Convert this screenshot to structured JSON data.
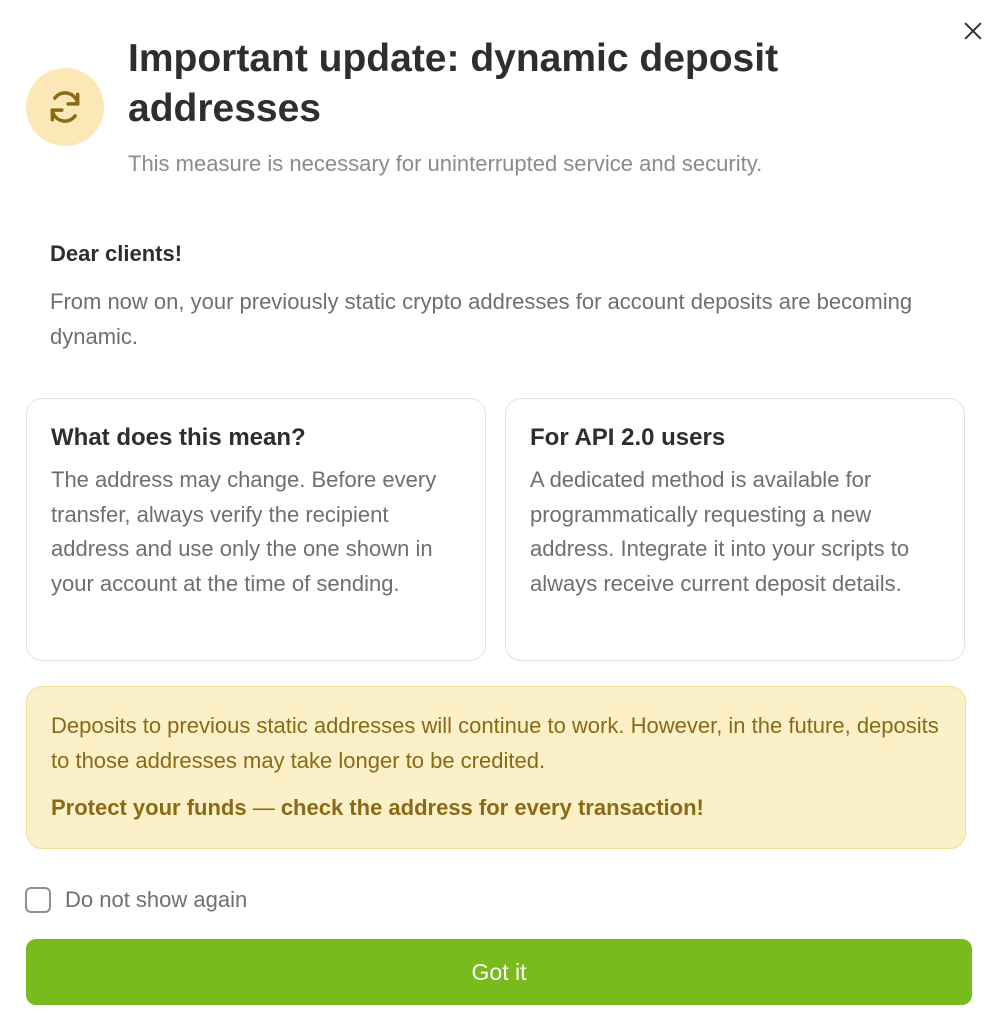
{
  "dialog": {
    "title": "Important update: dynamic deposit addresses",
    "subtitle": "This measure is necessary for uninterrupted service and security.",
    "icon": "refresh-icon",
    "close_icon": "close-icon"
  },
  "message": {
    "greeting": "Dear clients!",
    "intro": "From now on, your previously static crypto addresses for account deposits are becoming dynamic."
  },
  "cards": [
    {
      "title": "What does this mean?",
      "text": "The address may change. Before every transfer, always verify the recipient address and use only the one shown in your account at the time of sending."
    },
    {
      "title": "For API 2.0 users",
      "text": "A dedicated method is available for programmatically requesting a new address. Integrate it into your scripts to always receive current deposit details."
    }
  ],
  "notice": {
    "text": "Deposits to previous static addresses will continue to work. However, in the future, deposits to those addresses may take longer to be credited.",
    "warning_part1": "Protect your funds",
    "warning_dash": " — ",
    "warning_part2": "check the address for every transaction!"
  },
  "checkbox": {
    "label": "Do not show again",
    "checked": false
  },
  "button": {
    "label": "Got it"
  },
  "colors": {
    "accent_green": "#78bb1d",
    "icon_bg": "#fbe8b6",
    "icon_stroke": "#8a6a16",
    "notice_bg": "#fcf0c8",
    "notice_text": "#8a6a16"
  }
}
